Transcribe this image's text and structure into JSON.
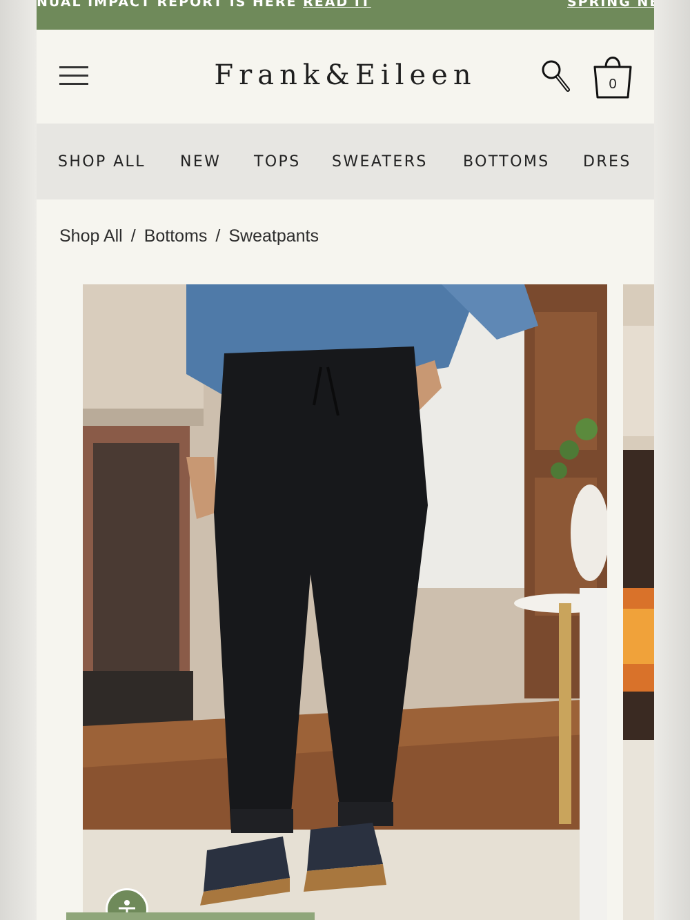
{
  "announcement": {
    "text": "NUAL IMPACT REPORT IS HERE",
    "link": "READ IT",
    "next_text": "SPRING NE"
  },
  "header": {
    "logo": "Frank&Eileen",
    "cart_count": "0",
    "menu_icon": "hamburger-icon",
    "search_icon": "search-icon",
    "bag_icon": "shopping-bag-icon"
  },
  "categories": [
    "SHOP ALL",
    "NEW",
    "TOPS",
    "SWEATERS",
    "BOTTOMS",
    "DRES"
  ],
  "breadcrumb": {
    "items": [
      "Shop All",
      "Bottoms",
      "Sweatpants"
    ],
    "separator": "/"
  },
  "colors": {
    "brand_green": "#6f8a5a",
    "page_bg": "#f6f5ef",
    "nav_bg": "#e7e6e2"
  }
}
